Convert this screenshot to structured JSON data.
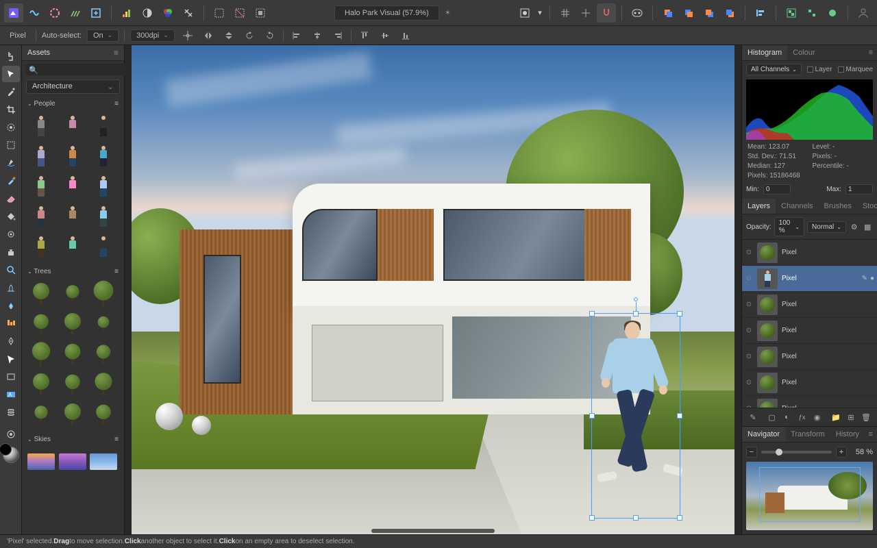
{
  "document": {
    "title": "Halo Park Visual (57.9%)"
  },
  "context": {
    "persona": "Pixel",
    "autoselect_label": "Auto-select:",
    "autoselect_value": "On",
    "dpi": "300dpi"
  },
  "assets": {
    "tab": "Assets",
    "search_placeholder": "",
    "category": "Architecture",
    "sections": {
      "people": "People",
      "trees": "Trees",
      "skies": "Skies"
    }
  },
  "histogram": {
    "tab_histogram": "Histogram",
    "tab_colour": "Colour",
    "channels": "All Channels",
    "check_layer": "Layer",
    "check_marquee": "Marquee",
    "stats": {
      "mean_label": "Mean:",
      "mean": "123.07",
      "stddev_label": "Std. Dev.:",
      "stddev": "71.51",
      "median_label": "Median:",
      "median": "127",
      "pixels_label": "Pixels:",
      "pixels": "15186468",
      "level_label": "Level:",
      "level": "-",
      "pixels2_label": "Pixels:",
      "pixels2": "-",
      "percentile_label": "Percentile:",
      "percentile": "-"
    },
    "min_label": "Min:",
    "min": "0",
    "max_label": "Max:",
    "max": "1"
  },
  "layers": {
    "tab_layers": "Layers",
    "tab_channels": "Channels",
    "tab_brushes": "Brushes",
    "tab_stock": "Stock",
    "opacity_label": "Opacity:",
    "opacity_value": "100 %",
    "blend": "Normal",
    "items": [
      {
        "name": "Pixel",
        "type": "tree"
      },
      {
        "name": "Pixel",
        "type": "person",
        "selected": true
      },
      {
        "name": "Pixel",
        "type": "tree"
      },
      {
        "name": "Pixel",
        "type": "tree"
      },
      {
        "name": "Pixel",
        "type": "tree"
      },
      {
        "name": "Pixel",
        "type": "tree"
      },
      {
        "name": "Pixel",
        "type": "tree"
      }
    ]
  },
  "navigator": {
    "tab_navigator": "Navigator",
    "tab_transform": "Transform",
    "tab_history": "History",
    "zoom": "58 %"
  },
  "status": {
    "text1": "'Pixel' selected. ",
    "drag_b": "Drag",
    "text2": " to move selection. ",
    "click_b": "Click",
    "text3": " another object to select it. ",
    "click2_b": "Click",
    "text4": " on an empty area to deselect selection."
  }
}
